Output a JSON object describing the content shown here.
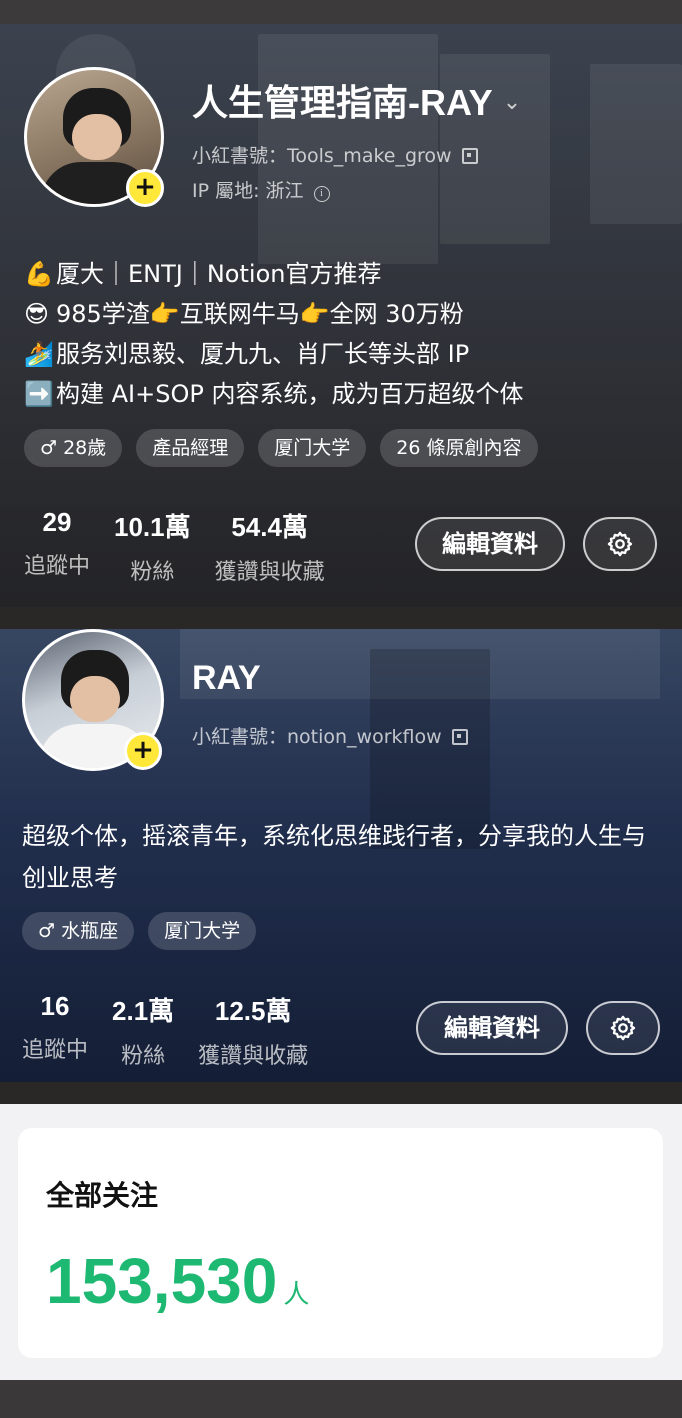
{
  "profile1": {
    "name": "人生管理指南-RAY",
    "id_label": "小紅書號：Tools_make_grow",
    "ip_label": "IP 屬地: 浙江",
    "bio": [
      {
        "icon": "💪",
        "text": "厦大｜ENTJ｜Notion官方推荐"
      },
      {
        "icon": "😎",
        "text": "985学渣👉互联网牛马👉全网 30万粉"
      },
      {
        "icon": "🏄",
        "text": "服务刘思毅、厦九九、肖厂长等头部 IP"
      },
      {
        "icon": "➡️",
        "text": "构建 AI+SOP 内容系统，成为百万超级个体"
      }
    ],
    "tags": [
      "♂ 28歲",
      "產品經理",
      "厦门大学",
      "26 條原創內容"
    ],
    "stats": [
      {
        "num": "29",
        "label": "追蹤中"
      },
      {
        "num": "10.1萬",
        "label": "粉絲"
      },
      {
        "num": "54.4萬",
        "label": "獲讚與收藏"
      }
    ],
    "edit_label": "編輯資料"
  },
  "profile2": {
    "name": "RAY",
    "id_label": "小紅書號：notion_workflow",
    "bio": "超级个体，摇滚青年，系统化思维践行者，分享我的人生与创业思考",
    "tags": [
      "♂ 水瓶座",
      "厦门大学"
    ],
    "stats": [
      {
        "num": "16",
        "label": "追蹤中"
      },
      {
        "num": "2.1萬",
        "label": "粉絲"
      },
      {
        "num": "12.5萬",
        "label": "獲讚與收藏"
      }
    ],
    "edit_label": "編輯資料"
  },
  "summary": {
    "title": "全部关注",
    "count": "153,530",
    "unit": "人"
  },
  "colors": {
    "accent_green": "#1db871",
    "plus_yellow": "#ffe83a"
  },
  "icons": [
    "plus-icon",
    "chevron-down-icon",
    "qr-code-icon",
    "info-icon",
    "gear-icon"
  ]
}
